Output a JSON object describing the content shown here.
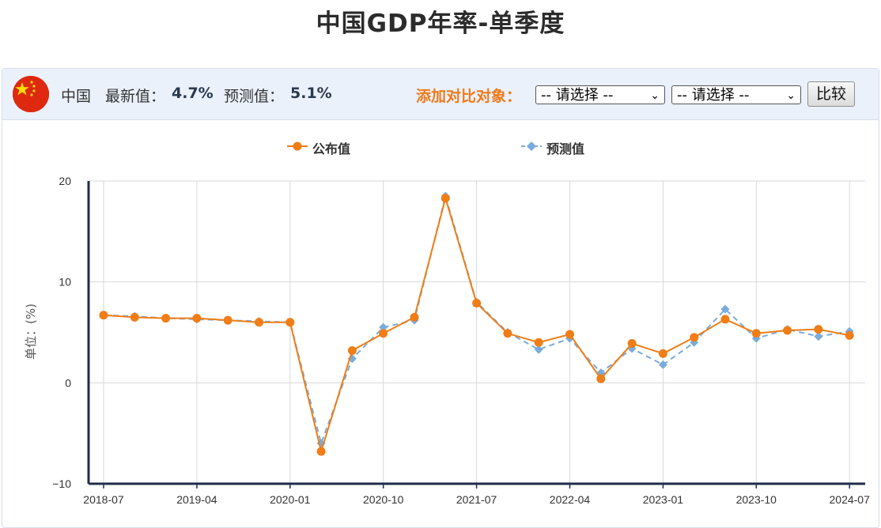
{
  "page": {
    "title": "中国GDP年率-单季度"
  },
  "info_bar": {
    "country": "中国",
    "latest_label": "最新值：",
    "latest_value": "4.7%",
    "forecast_label": "预测值：",
    "forecast_value": "5.1%",
    "compare_label": "添加对比对象：",
    "select_1_value": "-- 请选择 --",
    "select_2_value": "-- 请选择 --",
    "compare_button": "比较",
    "flag_icon": "china-flag-icon"
  },
  "colors": {
    "published": "#f07d16",
    "forecast": "#79acdd",
    "axis": "#1f2d4a",
    "grid": "#d9d9d9",
    "compare_label": "#f07a1a"
  },
  "chart_data": {
    "type": "line",
    "ylabel": "单位：(%)",
    "ylim": [
      -10,
      20
    ],
    "y_ticks": [
      "20",
      "10",
      "0",
      "-10"
    ],
    "x_tick_labels": [
      "2018-07",
      "2019-04",
      "2020-01",
      "2020-10",
      "2021-07",
      "2022-04",
      "2023-01",
      "2023-10",
      "2024-07"
    ],
    "x": [
      "2018-07",
      "2018-10",
      "2019-01",
      "2019-04",
      "2019-07",
      "2019-10",
      "2020-01",
      "2020-04",
      "2020-07",
      "2020-10",
      "2021-01",
      "2021-04",
      "2021-07",
      "2021-10",
      "2022-01",
      "2022-04",
      "2022-07",
      "2022-10",
      "2023-01",
      "2023-04",
      "2023-07",
      "2023-10",
      "2024-01",
      "2024-04",
      "2024-07"
    ],
    "legend_placement": "top",
    "grid": true,
    "series": [
      {
        "name": "公布值",
        "style": "solid-circle",
        "values": [
          6.7,
          6.5,
          6.4,
          6.4,
          6.2,
          6.0,
          6.0,
          -6.8,
          3.2,
          4.9,
          6.5,
          18.3,
          7.9,
          4.9,
          4.0,
          4.8,
          0.4,
          3.9,
          2.9,
          4.5,
          6.3,
          4.9,
          5.2,
          5.3,
          4.7
        ]
      },
      {
        "name": "预测值",
        "style": "dashed-diamond",
        "values": [
          6.7,
          6.6,
          6.4,
          6.3,
          6.2,
          6.1,
          6.0,
          -6.0,
          2.4,
          5.5,
          6.2,
          18.5,
          8.0,
          5.0,
          3.3,
          4.4,
          1.0,
          3.4,
          1.8,
          4.0,
          7.3,
          4.4,
          5.3,
          4.6,
          5.1
        ]
      }
    ]
  }
}
